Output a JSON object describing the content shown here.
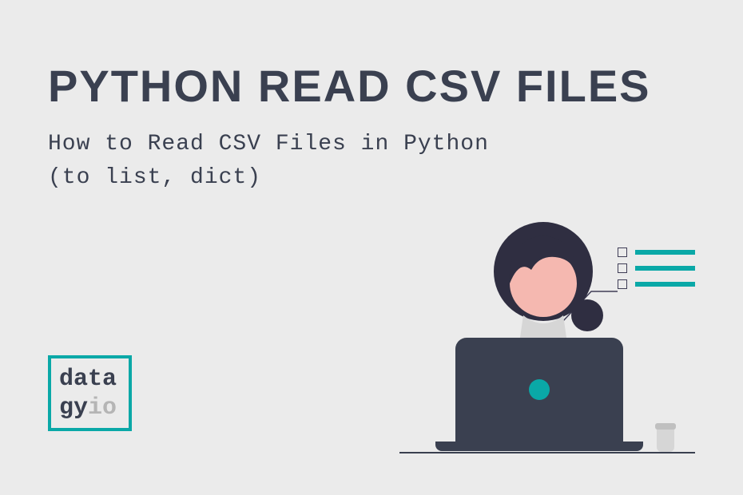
{
  "title": "PYTHON READ CSV FILES",
  "subtitle_line1": "How to Read CSV Files in Python",
  "subtitle_line2": "(to list, dict)",
  "logo": {
    "line1": "data",
    "line2_a": "gy",
    "line2_b": "io"
  },
  "colors": {
    "background": "#ebebeb",
    "dark": "#3a4050",
    "accent": "#0aa8a7",
    "skin": "#f5b8b0",
    "hair": "#2f2e41"
  }
}
